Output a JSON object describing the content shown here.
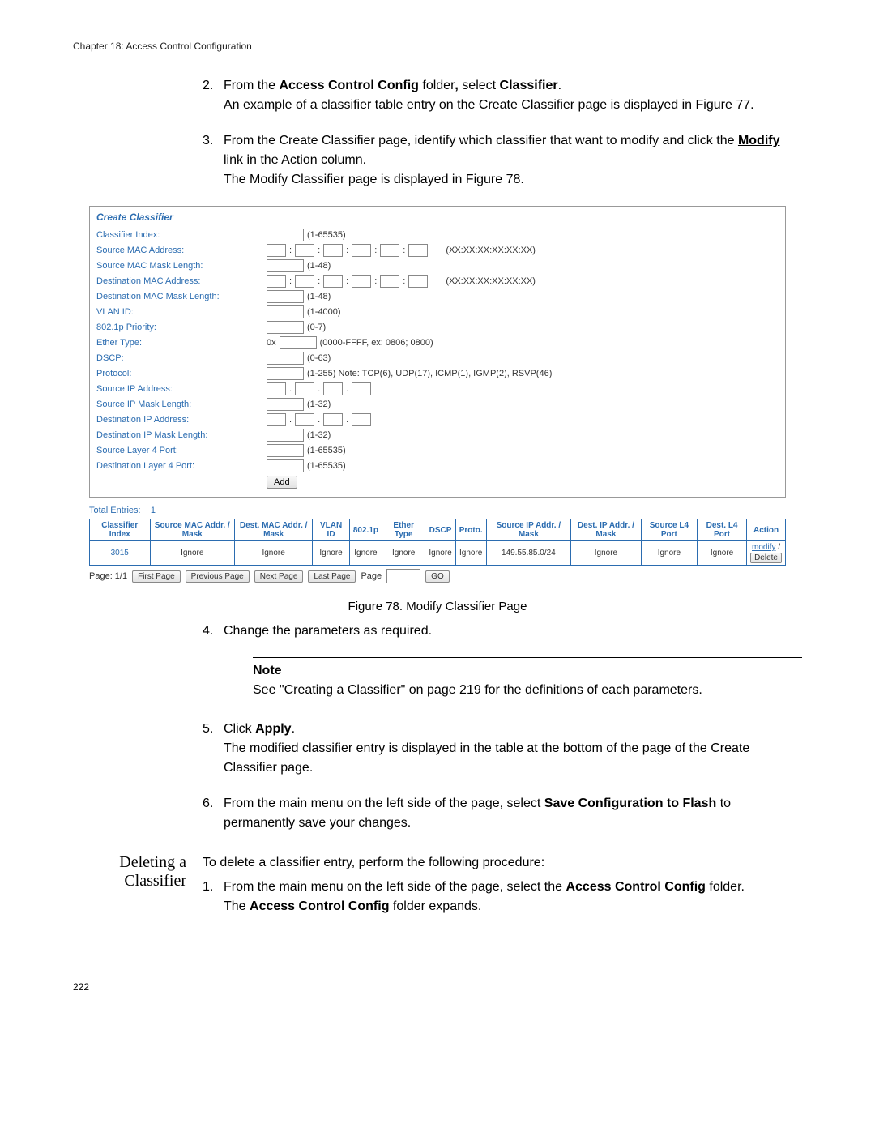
{
  "chapter_header": "Chapter 18: Access Control Configuration",
  "step2": {
    "num": "2.",
    "part1": "From the ",
    "bold1": "Access Control Config",
    "part2": " folder",
    "bold2": ",",
    "part3": " select ",
    "bold3": "Classifier",
    "part4": ".",
    "line2": "An example of a classifier table entry on the Create Classifier page is displayed in Figure 77."
  },
  "step3": {
    "num": "3.",
    "line1a": "From the Create Classifier page, identify which classifier that want to modify and click the ",
    "bold_u": "Modify",
    "line1b": " link in the Action column.",
    "line2": "The Modify Classifier page is displayed in Figure 78."
  },
  "classifier": {
    "title": "Create Classifier",
    "labels": {
      "index": "Classifier Index:",
      "src_mac": "Source MAC Address:",
      "src_mac_len": "Source MAC Mask Length:",
      "dst_mac": "Destination MAC Address:",
      "dst_mac_len": "Destination MAC Mask Length:",
      "vlan": "VLAN ID:",
      "pri": "802.1p Priority:",
      "ether": "Ether Type:",
      "dscp": "DSCP:",
      "proto": "Protocol:",
      "src_ip": "Source IP Address:",
      "src_ip_len": "Source IP Mask Length:",
      "dst_ip": "Destination IP Address:",
      "dst_ip_len": "Destination IP Mask Length:",
      "src_l4": "Source Layer 4 Port:",
      "dst_l4": "Destination Layer 4 Port:"
    },
    "hints": {
      "index": "(1-65535)",
      "mac_hint": "(XX:XX:XX:XX:XX:XX)",
      "len48": "(1-48)",
      "vlan": "(1-4000)",
      "pri": "(0-7)",
      "ether_prefix": "0x",
      "ether": "(0000-FFFF, ex: 0806; 0800)",
      "dscp": "(0-63)",
      "proto": "(1-255) Note: TCP(6), UDP(17), ICMP(1), IGMP(2), RSVP(46)",
      "ip_dot": ".",
      "len32": "(1-32)",
      "l4": "(1-65535)"
    },
    "add_btn": "Add"
  },
  "total_entries_label": "Total Entries:",
  "total_entries_value": "1",
  "table": {
    "headers": [
      "Classifier Index",
      "Source MAC Addr. / Mask",
      "Dest. MAC Addr. / Mask",
      "VLAN ID",
      "802.1p",
      "Ether Type",
      "DSCP",
      "Proto.",
      "Source IP Addr. / Mask",
      "Dest. IP Addr. / Mask",
      "Source L4 Port",
      "Dest. L4 Port",
      "Action"
    ],
    "row": {
      "cells": [
        "3015",
        "Ignore",
        "Ignore",
        "Ignore",
        "Ignore",
        "Ignore",
        "Ignore",
        "Ignore",
        "149.55.85.0/24",
        "Ignore",
        "Ignore",
        "Ignore"
      ],
      "modify": "modify",
      "delete": "Delete"
    }
  },
  "paginator": {
    "page_label": "Page: 1/1",
    "first": "First Page",
    "prev": "Previous Page",
    "next": "Next Page",
    "last": "Last Page",
    "page_word": "Page",
    "go": "GO"
  },
  "figure_caption": "Figure 78. Modify Classifier Page",
  "step4": {
    "num": "4.",
    "text": "Change the parameters as required."
  },
  "note": {
    "title": "Note",
    "body": "See \"Creating a Classifier\" on page 219 for the definitions of each parameters."
  },
  "step5": {
    "num": "5.",
    "a": "Click ",
    "bold": "Apply",
    "b": ".",
    "line2": "The modified classifier entry is displayed in the table at the bottom of the page of the Create Classifier page."
  },
  "step6": {
    "num": "6.",
    "a": "From the main menu on the left side of the page, select ",
    "b1": "Save Configuration to Flash",
    "c": " to permanently save your changes."
  },
  "deleting": {
    "heading": "Deleting a Classifier",
    "intro": "To delete a classifier entry, perform the following procedure:",
    "step1": {
      "num": "1.",
      "a": "From the main menu on the left side of the page, select the ",
      "b1": "Access Control Config",
      "c": " folder.",
      "line2a": "The ",
      "line2b": "Access Control Config",
      "line2c": " folder expands."
    }
  },
  "page_number": "222"
}
